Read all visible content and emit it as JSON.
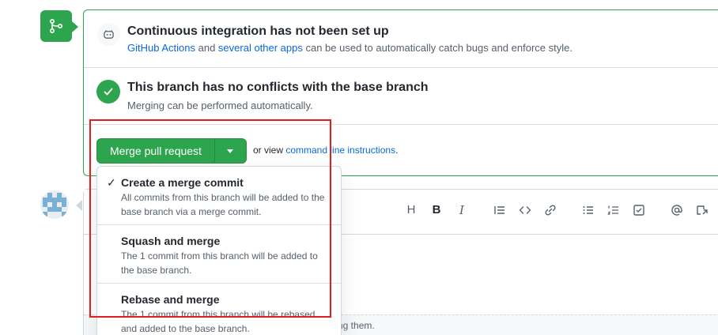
{
  "ci_section": {
    "title": "Continuous integration has not been set up",
    "link_actions": "GitHub Actions",
    "text_and": " and ",
    "link_apps": "several other apps",
    "text_rest": " can be used to automatically catch bugs and enforce style."
  },
  "conflict_section": {
    "title": "This branch has no conflicts with the base branch",
    "desc": "Merging can be performed automatically."
  },
  "merge_action": {
    "button_label": "Merge pull request",
    "or_view": "or view ",
    "cmd_link": "command line instructions",
    "period": "."
  },
  "dropdown": {
    "items": [
      {
        "title": "Create a merge commit",
        "desc": "All commits from this branch will be added to the base branch via a merge commit.",
        "selected": true
      },
      {
        "title": "Squash and merge",
        "desc": "The 1 commit from this branch will be added to the base branch.",
        "selected": false
      },
      {
        "title": "Rebase and merge",
        "desc": "The 1 commit from this branch will be rebased and added to the base branch.",
        "selected": false
      }
    ],
    "check_mark": "✓"
  },
  "comment": {
    "footer_text": "ng them."
  },
  "toolbar": {
    "heading": "H",
    "bold": "B",
    "italic": "I"
  },
  "colors": {
    "success": "#2da44e",
    "link": "#0969da",
    "highlight": "#e31c1c"
  }
}
